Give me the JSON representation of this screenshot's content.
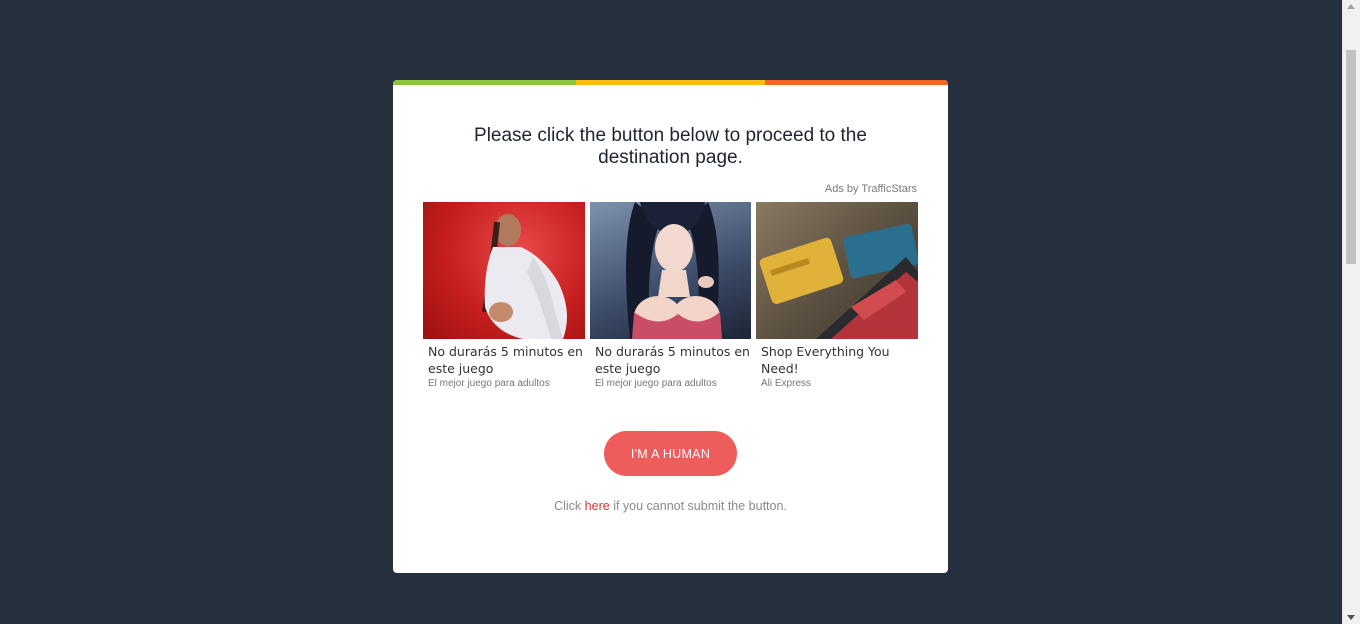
{
  "dialog": {
    "heading": "Please click the button below to proceed to the destination page.",
    "ads_label": "Ads by TrafficStars",
    "button_label": "I'M A HUMAN",
    "footer_prefix": "Click",
    "footer_link": "here",
    "footer_suffix": "if you cannot submit the button."
  },
  "ads": [
    {
      "title": "No durarás 5 minutos en este juego",
      "subtitle": "El mejor juego para adultos",
      "image": "woman-red-background-image"
    },
    {
      "title": "No durarás 5 minutos en este juego",
      "subtitle": "El mejor juego para adultos",
      "image": "anime-woman-image"
    },
    {
      "title": "Shop Everything You Need!",
      "subtitle": "Ali Express",
      "image": "credit-cards-tablet-image"
    }
  ],
  "colors": {
    "page_background": "#252f3e",
    "button": "#ef5c5c",
    "link": "#d8342e",
    "bar_green": "#8cc63f",
    "bar_yellow": "#f4c20d",
    "bar_orange": "#f26522"
  }
}
